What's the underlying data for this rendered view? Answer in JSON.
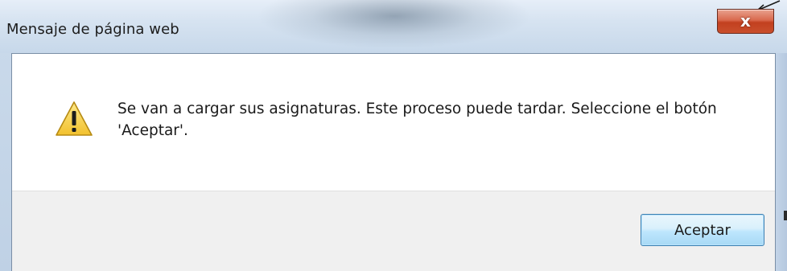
{
  "window": {
    "title": "Mensaje de página web",
    "close_glyph": "x"
  },
  "dialog": {
    "icon": "warning-icon",
    "message": "Se van a cargar sus asignaturas. Este proceso puede tardar. Seleccione el botón 'Aceptar'.",
    "ok_label": "Aceptar"
  },
  "colors": {
    "close_button": "#c94f2c",
    "warning_fill": "#f7d23b",
    "ok_button_border": "#3c7fb1",
    "footer_bg": "#f0f0f0"
  }
}
